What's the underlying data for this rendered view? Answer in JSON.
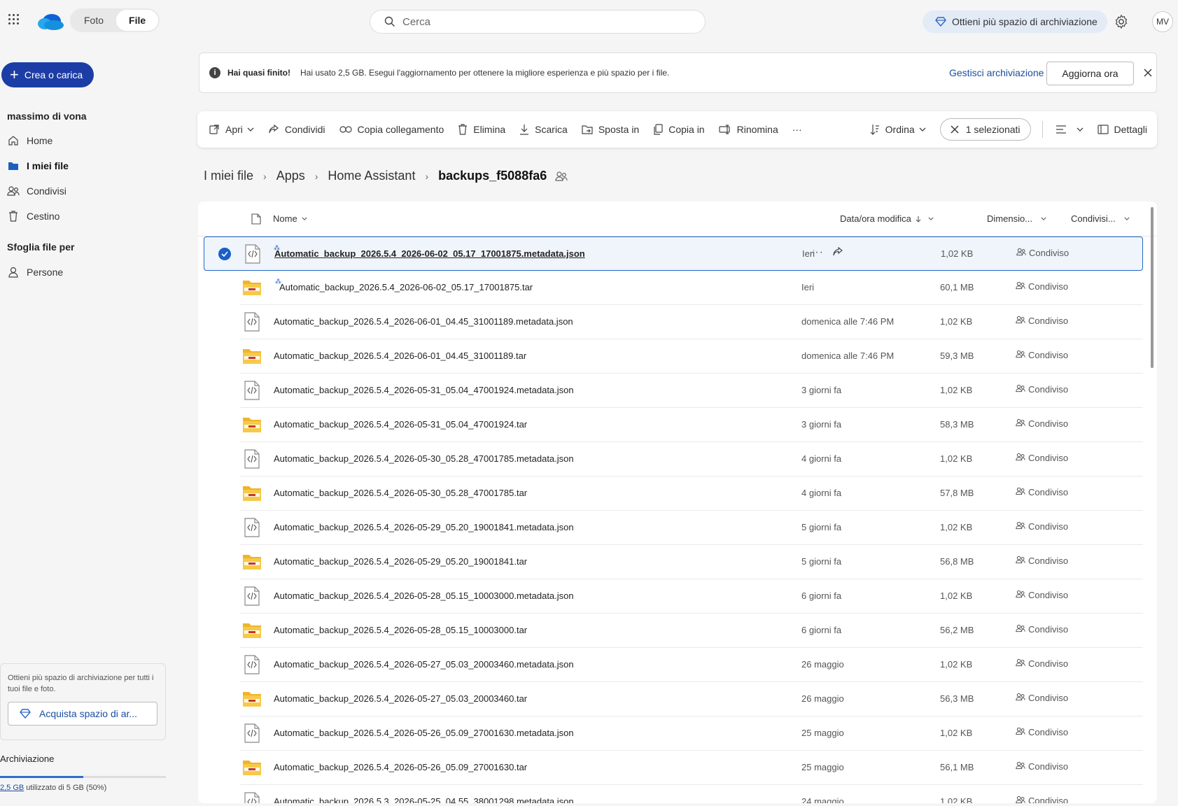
{
  "topbar": {
    "tabs": [
      {
        "label": "Foto",
        "active": false
      },
      {
        "label": "File",
        "active": true
      }
    ],
    "search_placeholder": "Cerca",
    "storage_promo": "Ottieni più spazio di archiviazione",
    "avatar_initials": "MV"
  },
  "sidebar": {
    "create_label": "Crea o carica",
    "user_name": "massimo di vona",
    "items": [
      {
        "label": "Home",
        "icon": "home-icon",
        "active": false
      },
      {
        "label": "I miei file",
        "icon": "folder-icon",
        "active": true
      },
      {
        "label": "Condivisi",
        "icon": "people-icon",
        "active": false
      },
      {
        "label": "Cestino",
        "icon": "trash-icon",
        "active": false
      }
    ],
    "browse_title": "Sfoglia file per",
    "browse_items": [
      {
        "label": "Persone",
        "icon": "person-icon"
      }
    ],
    "upgrade_text": "Ottieni più spazio di archiviazione per tutti i tuoi file e foto.",
    "buy_label": "Acquista spazio di ar...",
    "storage_title": "Archiviazione",
    "storage_used": "2,5 GB",
    "storage_rest": " utilizzato di 5 GB (50%)",
    "storage_fraction": 0.5
  },
  "banner": {
    "title": "Hai quasi finito!",
    "message": "Hai usato 2,5 GB. Esegui l'aggiornamento per ottenere la migliore esperienza e più spazio per i file.",
    "manage_label": "Gestisci archiviazione",
    "upgrade_label": "Aggiorna ora"
  },
  "commands": {
    "open": "Apri",
    "share": "Condividi",
    "copy_link": "Copia collegamento",
    "delete": "Elimina",
    "download": "Scarica",
    "move": "Sposta in",
    "copy": "Copia in",
    "rename": "Rinomina",
    "more": "···",
    "sort": "Ordina",
    "selected": "1 selezionati",
    "details": "Dettagli"
  },
  "breadcrumb": [
    "I miei file",
    "Apps",
    "Home Assistant",
    "backups_f5088fa6"
  ],
  "list": {
    "columns": {
      "name": "Nome",
      "modified": "Data/ora modifica",
      "size": "Dimensio...",
      "sharing": "Condivisi..."
    },
    "rows": [
      {
        "name": "Automatic_backup_2026.5.4_2026-06-02_05.17_17001875.metadata.json",
        "type": "json",
        "date": "Ieri",
        "size": "1,02 KB",
        "sharing": "Condiviso",
        "selected": true,
        "new": true
      },
      {
        "name": "Automatic_backup_2026.5.4_2026-06-02_05.17_17001875.tar",
        "type": "tar",
        "date": "Ieri",
        "size": "60,1 MB",
        "sharing": "Condiviso",
        "selected": false,
        "new": true
      },
      {
        "name": "Automatic_backup_2026.5.4_2026-06-01_04.45_31001189.metadata.json",
        "type": "json",
        "date": "domenica alle 7:46 PM",
        "size": "1,02 KB",
        "sharing": "Condiviso",
        "selected": false,
        "new": false
      },
      {
        "name": "Automatic_backup_2026.5.4_2026-06-01_04.45_31001189.tar",
        "type": "tar",
        "date": "domenica alle 7:46 PM",
        "size": "59,3 MB",
        "sharing": "Condiviso",
        "selected": false,
        "new": false
      },
      {
        "name": "Automatic_backup_2026.5.4_2026-05-31_05.04_47001924.metadata.json",
        "type": "json",
        "date": "3 giorni fa",
        "size": "1,02 KB",
        "sharing": "Condiviso",
        "selected": false,
        "new": false
      },
      {
        "name": "Automatic_backup_2026.5.4_2026-05-31_05.04_47001924.tar",
        "type": "tar",
        "date": "3 giorni fa",
        "size": "58,3 MB",
        "sharing": "Condiviso",
        "selected": false,
        "new": false
      },
      {
        "name": "Automatic_backup_2026.5.4_2026-05-30_05.28_47001785.metadata.json",
        "type": "json",
        "date": "4 giorni fa",
        "size": "1,02 KB",
        "sharing": "Condiviso",
        "selected": false,
        "new": false
      },
      {
        "name": "Automatic_backup_2026.5.4_2026-05-30_05.28_47001785.tar",
        "type": "tar",
        "date": "4 giorni fa",
        "size": "57,8 MB",
        "sharing": "Condiviso",
        "selected": false,
        "new": false
      },
      {
        "name": "Automatic_backup_2026.5.4_2026-05-29_05.20_19001841.metadata.json",
        "type": "json",
        "date": "5 giorni fa",
        "size": "1,02 KB",
        "sharing": "Condiviso",
        "selected": false,
        "new": false
      },
      {
        "name": "Automatic_backup_2026.5.4_2026-05-29_05.20_19001841.tar",
        "type": "tar",
        "date": "5 giorni fa",
        "size": "56,8 MB",
        "sharing": "Condiviso",
        "selected": false,
        "new": false
      },
      {
        "name": "Automatic_backup_2026.5.4_2026-05-28_05.15_10003000.metadata.json",
        "type": "json",
        "date": "6 giorni fa",
        "size": "1,02 KB",
        "sharing": "Condiviso",
        "selected": false,
        "new": false
      },
      {
        "name": "Automatic_backup_2026.5.4_2026-05-28_05.15_10003000.tar",
        "type": "tar",
        "date": "6 giorni fa",
        "size": "56,2 MB",
        "sharing": "Condiviso",
        "selected": false,
        "new": false
      },
      {
        "name": "Automatic_backup_2026.5.4_2026-05-27_05.03_20003460.metadata.json",
        "type": "json",
        "date": "26 maggio",
        "size": "1,02 KB",
        "sharing": "Condiviso",
        "selected": false,
        "new": false
      },
      {
        "name": "Automatic_backup_2026.5.4_2026-05-27_05.03_20003460.tar",
        "type": "tar",
        "date": "26 maggio",
        "size": "56,3 MB",
        "sharing": "Condiviso",
        "selected": false,
        "new": false
      },
      {
        "name": "Automatic_backup_2026.5.4_2026-05-26_05.09_27001630.metadata.json",
        "type": "json",
        "date": "25 maggio",
        "size": "1,02 KB",
        "sharing": "Condiviso",
        "selected": false,
        "new": false
      },
      {
        "name": "Automatic_backup_2026.5.4_2026-05-26_05.09_27001630.tar",
        "type": "tar",
        "date": "25 maggio",
        "size": "56,1 MB",
        "sharing": "Condiviso",
        "selected": false,
        "new": false
      },
      {
        "name": "Automatic_backup_2026.5.3_2026-05-25_04.55_38001298.metadata.json",
        "type": "json",
        "date": "24 maggio",
        "size": "1,02 KB",
        "sharing": "Condiviso",
        "selected": false,
        "new": false
      }
    ]
  },
  "colors": {
    "accent": "#1d3da6",
    "link": "#1a4fa0",
    "folder": "#f0b429"
  }
}
